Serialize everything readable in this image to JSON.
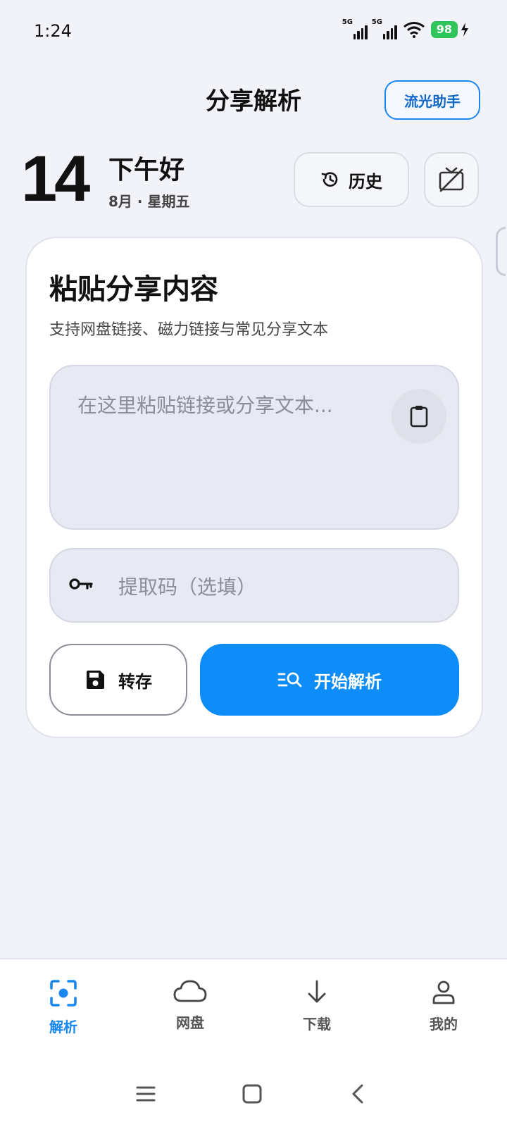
{
  "status": {
    "time": "1:24",
    "network1": "5G",
    "network2": "5G",
    "battery": "98"
  },
  "header": {
    "title": "分享解析",
    "assistant_label": "流光助手"
  },
  "date": {
    "day": "14",
    "greeting": "下午好",
    "subtitle": "8月 · 星期五"
  },
  "actions": {
    "history_label": "历史"
  },
  "card": {
    "title": "粘贴分享内容",
    "subtitle": "支持网盘链接、磁力链接与常见分享文本",
    "textarea_placeholder": "在这里粘贴链接或分享文本...",
    "code_placeholder": "提取码（选填）",
    "save_label": "转存",
    "parse_label": "开始解析"
  },
  "nav": {
    "items": [
      {
        "label": "解析",
        "icon": "scan-icon",
        "active": true
      },
      {
        "label": "网盘",
        "icon": "cloud-icon",
        "active": false
      },
      {
        "label": "下载",
        "icon": "download-icon",
        "active": false
      },
      {
        "label": "我的",
        "icon": "user-icon",
        "active": false
      }
    ]
  },
  "colors": {
    "accent": "#1a86ef",
    "primary_button": "#0e8cf7",
    "background": "#f1f3f8",
    "battery": "#2fc55a"
  }
}
